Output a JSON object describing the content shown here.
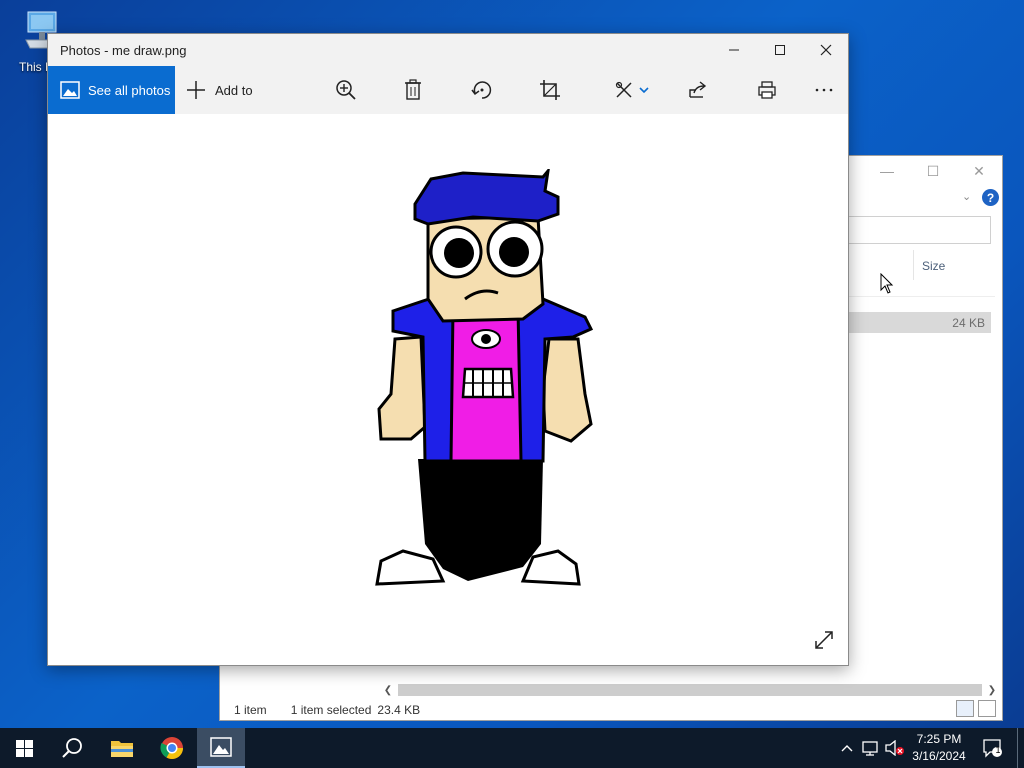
{
  "desktop": {
    "this_pc_label": "This PC"
  },
  "explorer": {
    "size_header": "Size",
    "row_size": "24 KB",
    "status_items": "1 item",
    "status_selected": "1 item selected",
    "status_size": "23.4 KB"
  },
  "photos": {
    "title": "Photos - me draw.png",
    "see_all_label": "See all photos",
    "add_to_label": "Add to",
    "toolbar_icons": [
      "zoom-icon",
      "delete-icon",
      "rotate-icon",
      "crop-icon",
      "edit-icon",
      "share-icon",
      "print-icon",
      "more-icon"
    ],
    "accent_color": "#0a6cd0"
  },
  "taskbar": {
    "time": "7:25 PM",
    "date": "3/16/2024",
    "notification_count": "1"
  }
}
